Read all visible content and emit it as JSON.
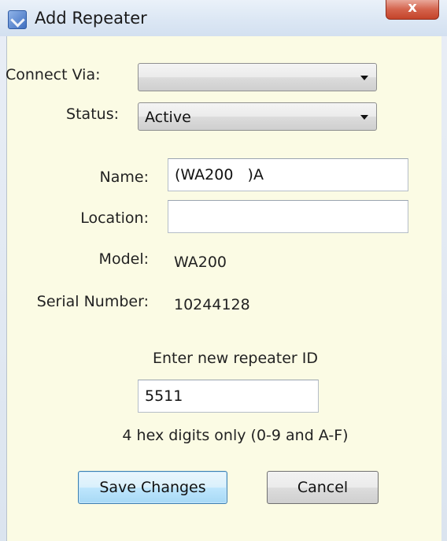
{
  "window": {
    "title": "Add Repeater",
    "close_label": "x"
  },
  "form": {
    "connect_via_label": "Connect Via:",
    "connect_via_value": "",
    "status_label": "Status:",
    "status_value": "Active",
    "name_label": "Name:",
    "name_value": "(WA200   )A",
    "location_label": "Location:",
    "location_value": "",
    "model_label": "Model:",
    "model_value": "WA200",
    "serial_label": "Serial Number:",
    "serial_value": "10244128",
    "repeater_id_prompt": "Enter new repeater ID",
    "repeater_id_value": "5511",
    "repeater_id_hint": "4 hex digits only (0-9 and A-F)"
  },
  "buttons": {
    "save_label": "Save Changes",
    "cancel_label": "Cancel"
  },
  "icons": {
    "app": "app-window-icon",
    "close": "close-icon",
    "dropdown": "chevron-down-icon"
  },
  "colors": {
    "content_background": "#fbfbe4",
    "close_button": "#c4442a",
    "default_button_border": "#3c7fb1"
  }
}
